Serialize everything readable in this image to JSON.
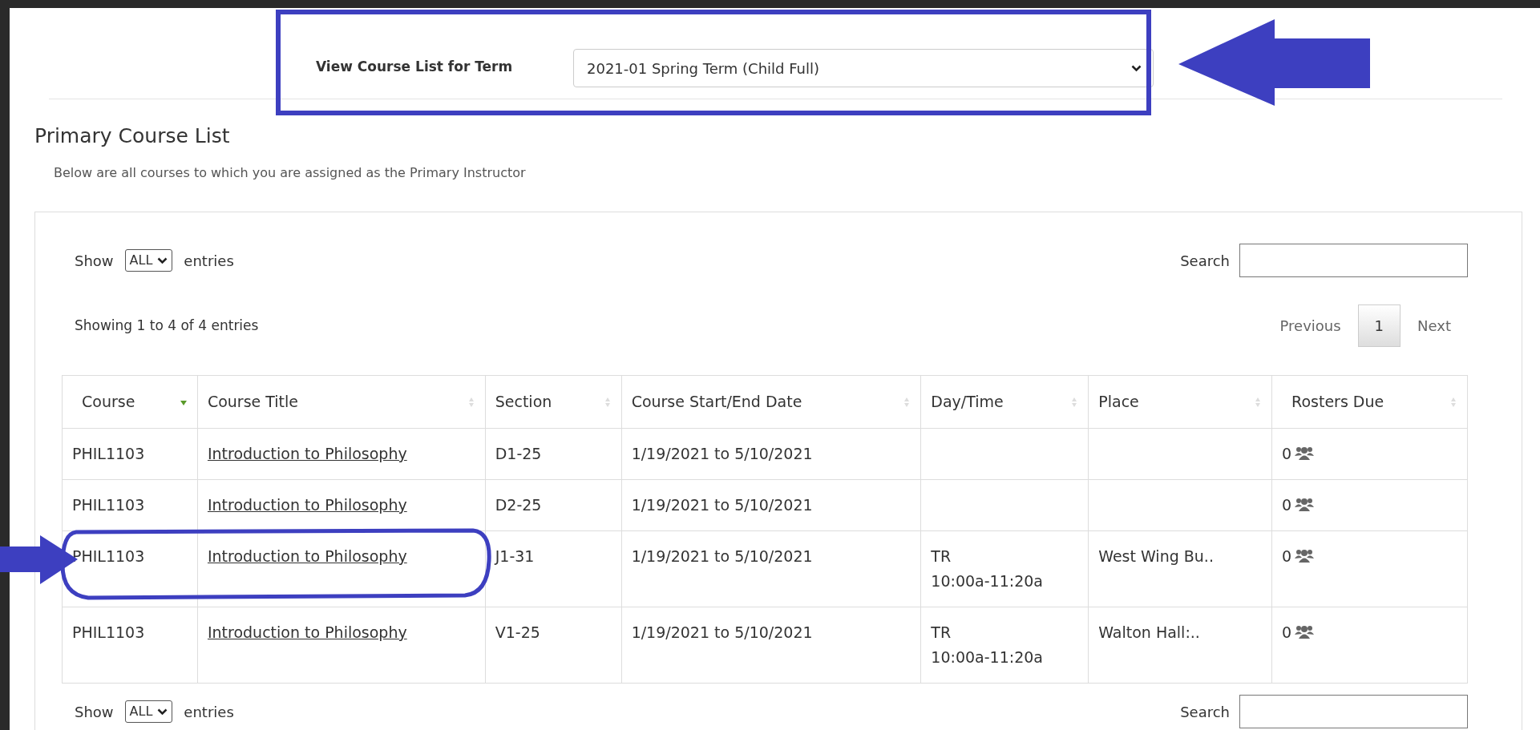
{
  "term_selector": {
    "label": "View Course List for Term",
    "value": "2021-01 Spring Term (Child Full)"
  },
  "heading": "Primary Course List",
  "description": "Below are all courses to which you are assigned as the Primary Instructor",
  "length_control": {
    "prefix": "Show",
    "value": "ALL",
    "suffix": "entries"
  },
  "search": {
    "label": "Search"
  },
  "info": "Showing 1 to 4 of 4 entries",
  "pagination": {
    "previous": "Previous",
    "pages": [
      {
        "label": "1",
        "selected": true
      }
    ],
    "next": "Next"
  },
  "table": {
    "columns": [
      {
        "label": "Course",
        "sorted": true
      },
      {
        "label": "Course Title",
        "sorted": false
      },
      {
        "label": "Section",
        "sorted": false
      },
      {
        "label": "Course Start/End Date",
        "sorted": false
      },
      {
        "label": "Day/Time",
        "sorted": false
      },
      {
        "label": "Place",
        "sorted": false
      },
      {
        "label": "Rosters Due",
        "sorted": false
      }
    ],
    "rows": [
      {
        "course": "PHIL1103",
        "title": "Introduction to Philosophy",
        "section": "D1-25",
        "dates": "1/19/2021 to 5/10/2021",
        "rosters_due": "0"
      },
      {
        "course": "PHIL1103",
        "title": "Introduction to Philosophy",
        "section": "D2-25",
        "dates": "1/19/2021 to 5/10/2021",
        "rosters_due": "0"
      },
      {
        "course": "PHIL1103",
        "title": "Introduction to Philosophy",
        "section": "J1-31",
        "dates": "1/19/2021 to 5/10/2021",
        "day": "TR",
        "time": "10:00a-11:20a",
        "place": "West Wing Bu..",
        "rosters_due": "0"
      },
      {
        "course": "PHIL1103",
        "title": "Introduction to Philosophy",
        "section": "V1-25",
        "dates": "1/19/2021 to 5/10/2021",
        "day": "TR",
        "time": "10:00a-11:20a",
        "place": "Walton Hall:..",
        "rosters_due": "0"
      }
    ]
  },
  "bottom_length_control": {
    "prefix": "Show",
    "value": "ALL",
    "suffix": "entries"
  },
  "bottom_search": {
    "label": "Search"
  },
  "annotations": [
    {
      "kind": "rectangle"
    },
    {
      "kind": "left_arrow"
    },
    {
      "kind": "right_arrow"
    },
    {
      "kind": "ellipse"
    }
  ]
}
